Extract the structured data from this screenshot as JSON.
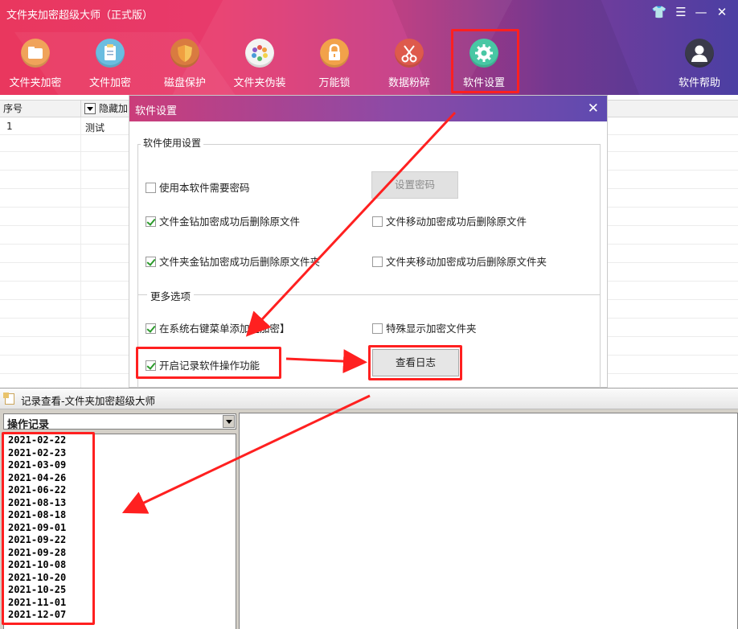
{
  "app": {
    "title": "文件夹加密超级大师（正式版）",
    "window_controls": [
      "👕",
      "☰",
      "—",
      "✕"
    ]
  },
  "toolbar": {
    "items": [
      {
        "label": "文件夹加密",
        "icon": "folder-icon",
        "color": "#f0a35a"
      },
      {
        "label": "文件加密",
        "icon": "document-icon",
        "color": "#6bbde0"
      },
      {
        "label": "磁盘保护",
        "icon": "shield-icon",
        "color": "#e08a3a"
      },
      {
        "label": "文件夹伪装",
        "icon": "palette-icon",
        "color": "#f2f2f2"
      },
      {
        "label": "万能锁",
        "icon": "lock-icon",
        "color": "#f2a24a"
      },
      {
        "label": "数据粉碎",
        "icon": "scissors-icon",
        "color": "#e06050"
      },
      {
        "label": "软件设置",
        "icon": "gear-icon",
        "color": "#48c7a4"
      },
      {
        "label": "软件帮助",
        "icon": "user-icon",
        "color": "#ffffff"
      }
    ]
  },
  "file_table": {
    "headers": [
      "序号",
      "隐藏加"
    ],
    "rows": [
      {
        "index": "1",
        "name": "测试"
      }
    ]
  },
  "settings_dialog": {
    "title": "软件设置",
    "close": "✕",
    "group_title": "软件使用设置",
    "require_password": {
      "label": "使用本软件需要密码",
      "checked": false
    },
    "set_password_button": "设置密码",
    "options": [
      {
        "label": "文件金钻加密成功后删除原文件",
        "checked": true
      },
      {
        "label": "文件移动加密成功后删除原文件",
        "checked": false
      },
      {
        "label": "文件夹金钻加密成功后删除原文件夹",
        "checked": true
      },
      {
        "label": "文件夹移动加密成功后删除原文件夹",
        "checked": false
      }
    ],
    "more_title": "更多选项",
    "context_menu": {
      "label": "在系统右键菜单添加【加密】",
      "checked": true
    },
    "special_display": {
      "label": "特殊显示加密文件夹",
      "checked": false
    },
    "enable_log": {
      "label": "开启记录软件操作功能",
      "checked": true
    },
    "view_log_button": "查看日志"
  },
  "log_window": {
    "title": "记录查看-文件夹加密超级大师",
    "combo_value": "操作记录",
    "entries": [
      "2021-02-22",
      "2021-02-23",
      "2021-03-09",
      "2021-04-26",
      "2021-06-22",
      "2021-08-13",
      "2021-08-18",
      "2021-09-01",
      "2021-09-22",
      "2021-09-28",
      "2021-10-08",
      "2021-10-20",
      "2021-10-25",
      "2021-11-01",
      "2021-12-07"
    ]
  },
  "colors": {
    "highlight": "#ff2020",
    "checkmark": "#2a9a2a"
  }
}
